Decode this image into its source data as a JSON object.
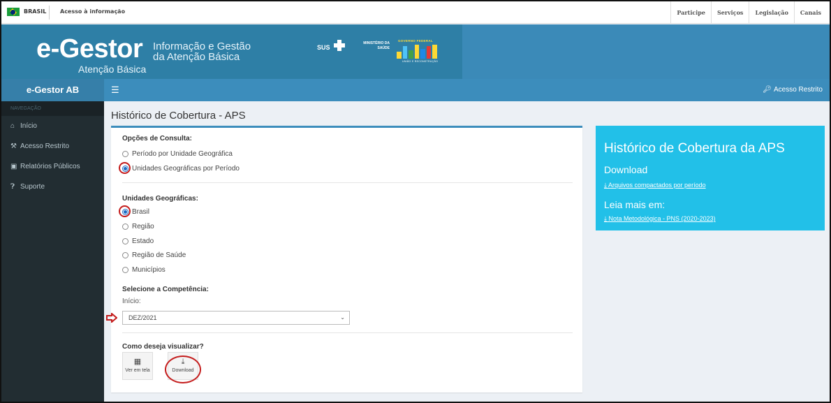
{
  "govbar": {
    "country": "BRASIL",
    "access_info": "Acesso à informação",
    "links": [
      "Participe",
      "Serviços",
      "Legislação",
      "Canais"
    ]
  },
  "banner": {
    "logo": "e-Gestor",
    "logo_sub": "Atenção Básica",
    "tagline_line1": "Informação e Gestão",
    "tagline_line2": "da Atenção Básica",
    "sus": "SUS",
    "ministerio_line1": "MINISTÉRIO DA",
    "ministerio_line2": "SAÚDE",
    "gov_label": "GOVERNO FEDERAL",
    "gov_foot": "UNIÃO E RECONSTRUÇÃO"
  },
  "navbar": {
    "brand": "e-Gestor AB",
    "menu_icon": "hamburger-icon",
    "restricted_label": "Acesso Restrito"
  },
  "sidebar": {
    "header": "NAVEGAÇÃO",
    "items": [
      {
        "label": "Início",
        "icon": "home-icon"
      },
      {
        "label": "Acesso Restrito",
        "icon": "key-icon"
      },
      {
        "label": "Relatórios Públicos",
        "icon": "laptop-icon"
      },
      {
        "label": "Suporte",
        "icon": "help-icon"
      }
    ]
  },
  "main": {
    "title": "Histórico de Cobertura - APS",
    "query_options_title": "Opções de Consulta:",
    "query_options": [
      {
        "label": "Período por Unidade Geográfica",
        "checked": false
      },
      {
        "label": "Unidades Geográficas por Período",
        "checked": true
      }
    ],
    "geo_units_title": "Unidades Geográficas:",
    "geo_units": [
      {
        "label": "Brasil",
        "checked": true
      },
      {
        "label": "Região",
        "checked": false
      },
      {
        "label": "Estado",
        "checked": false
      },
      {
        "label": "Região de Saúde",
        "checked": false
      },
      {
        "label": "Municípios",
        "checked": false
      }
    ],
    "competencia_title": "Selecione a Competência:",
    "inicio_label": "Início:",
    "inicio_value": "DEZ/2021",
    "view_title": "Como deseja visualizar?",
    "view_buttons": [
      {
        "label": "Ver em tela",
        "icon": "table-icon"
      },
      {
        "label": "Download",
        "icon": "download-icon"
      }
    ]
  },
  "info": {
    "title": "Histórico de Cobertura da APS",
    "download_heading": "Download",
    "download_link": "Arquivos compactados por período",
    "read_more_heading": "Leia mais em:",
    "read_more_link": "Nota Metodológica - PNS (2020-2023)"
  },
  "colors": {
    "navbar": "#3c8dbc",
    "sidebar": "#222d32",
    "info_box": "#22c0e8",
    "annotation_red": "#c41c1c"
  }
}
